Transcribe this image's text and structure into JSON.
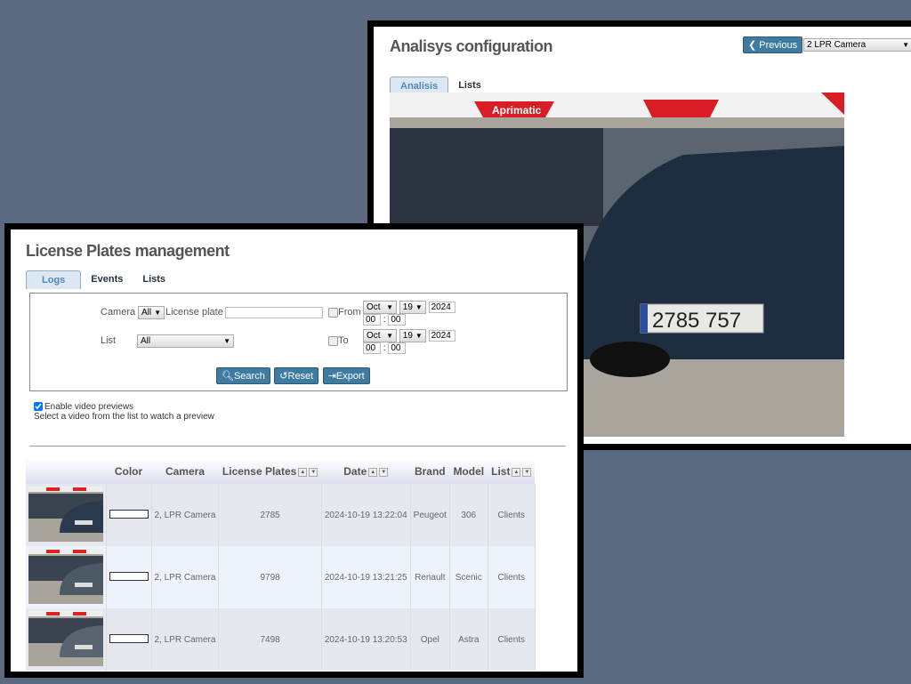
{
  "analysis": {
    "title": "Analisys configuration",
    "previous_label": "Previous",
    "camera_select": "2 LPR Camera",
    "tabs": [
      {
        "label": "Analisis",
        "active": true
      },
      {
        "label": "Lists",
        "active": false
      }
    ],
    "image_text": {
      "barrier_brand": "Aprimatic",
      "plate": "2785 757"
    }
  },
  "plates": {
    "title": "License Plates management",
    "tabs": [
      {
        "label": "Logs",
        "active": true
      },
      {
        "label": "Events"
      },
      {
        "label": "Lists"
      }
    ],
    "filters": {
      "camera_label": "Camera",
      "camera_value": "All",
      "plate_label": "License plate",
      "plate_value": "",
      "list_label": "List",
      "list_value": "All",
      "from_label": "From",
      "to_label": "To",
      "from": {
        "month": "Oct",
        "day": "19",
        "year": "2024",
        "hour": "00",
        "minute": "00"
      },
      "to": {
        "month": "Oct",
        "day": "19",
        "year": "2024",
        "hour": "00",
        "minute": "00"
      },
      "colon": ":"
    },
    "buttons": {
      "search": "Search",
      "reset": "Reset",
      "export": "Export"
    },
    "preview_label": "Enable video previews",
    "preview_checked": true,
    "preview_hint": "Select a video from the list to watch a preview",
    "columns": [
      "",
      "Color",
      "Camera",
      "License Plates",
      "Date",
      "Brand",
      "Model",
      "List"
    ],
    "rows": [
      {
        "color": "#ffffff",
        "camera": "2, LPR Camera",
        "plate": "2785",
        "date": "2024-10-19 13:22:04",
        "brand": "Peugeot",
        "model": "306",
        "list": "Clients"
      },
      {
        "color": "#ffffff",
        "camera": "2, LPR Camera",
        "plate": "9798",
        "date": "2024-10-19 13:21:25",
        "brand": "Renault",
        "model": "Scenic",
        "list": "Clients"
      },
      {
        "color": "#ffffff",
        "camera": "2, LPR Camera",
        "plate": "7498",
        "date": "2024-10-19 13:20:53",
        "brand": "Opel",
        "model": "Astra",
        "list": "Clients"
      }
    ]
  },
  "colors": {
    "background": "#5b6a80",
    "button": "#3f7aa0",
    "tab_active": "#dde6f3"
  }
}
